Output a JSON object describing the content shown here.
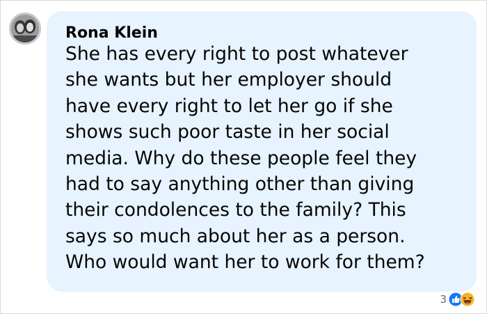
{
  "comment": {
    "author": "Rona Klein",
    "text": "She has every right to post whatever\nshe wants but her employer should\nhave every right to let her go if she\nshows such poor taste in her social\nmedia. Why do these people feel they\nhad to say anything other than giving\ntheir condolences to the family? This\nsays so much about her as a person.\nWho would want her to work for them?",
    "reaction_count": "3",
    "reactions": [
      "like-icon",
      "haha-icon"
    ]
  },
  "colors": {
    "bubble_bg": "#e7f3ff",
    "text": "#050505",
    "meta_text": "#65676b",
    "like_blue": "#1877f2",
    "haha_yellow": "#f7b125"
  }
}
